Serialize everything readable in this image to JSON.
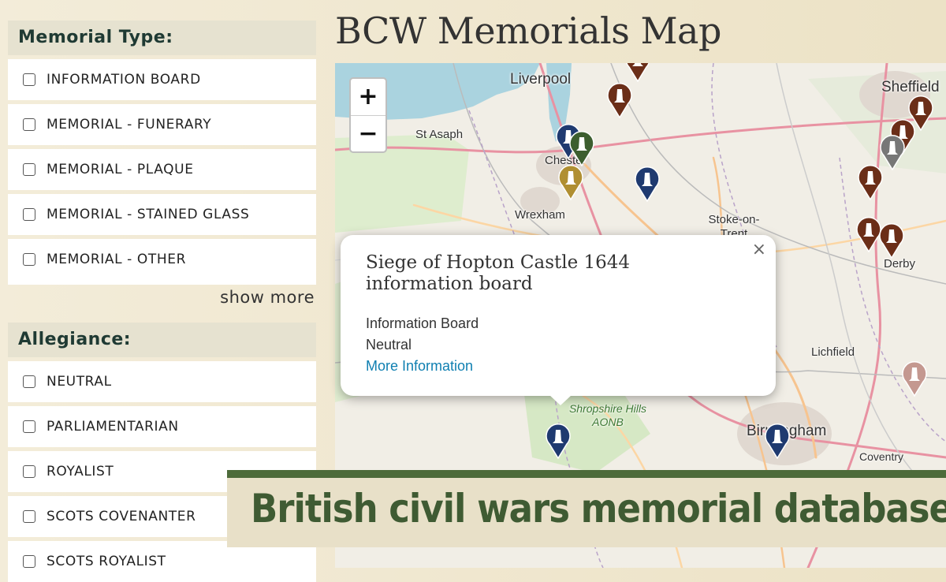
{
  "page": {
    "title": "BCW Memorials Map"
  },
  "filters": {
    "memorial_type": {
      "heading": "Memorial Type:",
      "options": [
        "INFORMATION BOARD",
        "MEMORIAL - FUNERARY",
        "MEMORIAL - PLAQUE",
        "MEMORIAL - STAINED GLASS",
        "MEMORIAL - OTHER"
      ],
      "show_more": "show more"
    },
    "allegiance": {
      "heading": "Allegiance:",
      "options": [
        "NEUTRAL",
        "PARLIAMENTARIAN",
        "ROYALIST",
        "SCOTS COVENANTER",
        "SCOTS ROYALIST"
      ]
    }
  },
  "map": {
    "zoom_in": "+",
    "zoom_out": "−",
    "places": [
      "Liverpool",
      "Sheffield",
      "St Asaph",
      "Chester",
      "Wrexham",
      "Stoke-on-Trent",
      "Derby",
      "Lichfield",
      "Shropshire Hills AONB",
      "Birmingham",
      "Coventry"
    ],
    "pin_colors": {
      "neutral": "#1f3a70",
      "royalist": "#6b2e18",
      "parliamentarian": "#3d5e2f",
      "other": "#b08f32",
      "grey": "#777777",
      "pink": "#c49890"
    }
  },
  "popup": {
    "title": "Siege of Hopton Castle 1644 information board",
    "close": "×",
    "type": "Information Board",
    "allegiance": "Neutral",
    "link": "More Information"
  },
  "banner": {
    "text": "British civil wars memorial database"
  }
}
